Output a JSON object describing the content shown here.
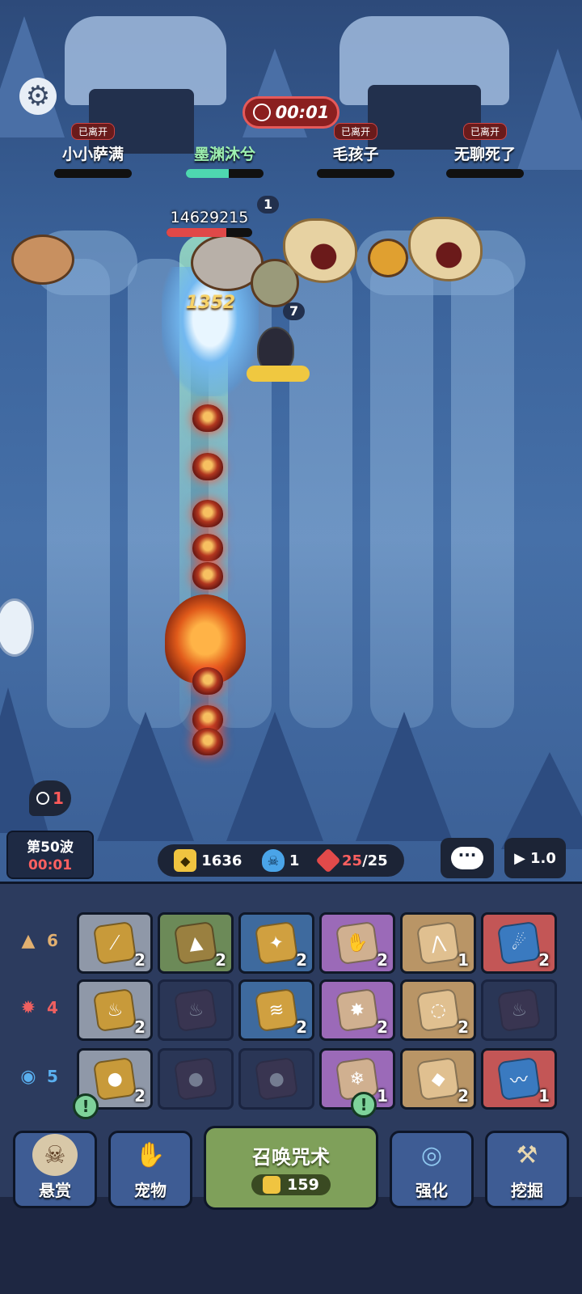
{
  "top": {
    "timer": "00:01",
    "players": [
      {
        "status": "已离开",
        "name": "小小萨满",
        "hp": 0
      },
      {
        "status": "",
        "name": "墨渊沐兮",
        "hp": 0.55
      },
      {
        "status": "已离开",
        "name": "毛孩子",
        "hp": 0
      },
      {
        "status": "已离开",
        "name": "无聊死了",
        "hp": 0
      }
    ]
  },
  "battle": {
    "boss_hp_value": "14629215",
    "boss_hp_fraction": 0.7,
    "badge_a": "1",
    "badge_b": "7",
    "damage_float": "1352",
    "side_timer": "1"
  },
  "wave": {
    "label": "第50波",
    "time": "00:01"
  },
  "resources": {
    "gold": "1636",
    "souls": "1",
    "gems_current": "25",
    "gems_sep": "/",
    "gems_max": "25"
  },
  "speed": "1.0",
  "elements": [
    {
      "count": "6",
      "icon": "mountain-icon",
      "color": "#e2b070",
      "cards": [
        {
          "color": "grey",
          "icon": "claw",
          "count": "2"
        },
        {
          "color": "green",
          "icon": "boulder",
          "count": "2"
        },
        {
          "color": "blue",
          "icon": "rocks",
          "count": "2"
        },
        {
          "color": "purple",
          "icon": "hand",
          "count": "2"
        },
        {
          "color": "tan",
          "icon": "spikes",
          "count": "1"
        },
        {
          "color": "red",
          "icon": "meteor",
          "count": "2"
        }
      ]
    },
    {
      "count": "4",
      "icon": "fire-icon",
      "color": "#f06060",
      "cards": [
        {
          "color": "grey",
          "icon": "flame",
          "count": "2"
        },
        {
          "color": "empty",
          "icon": "fire-locked",
          "count": ""
        },
        {
          "color": "blue",
          "icon": "fire-wave",
          "count": "2"
        },
        {
          "color": "purple",
          "icon": "explosion",
          "count": "2"
        },
        {
          "color": "tan",
          "icon": "tornado",
          "count": "2"
        },
        {
          "color": "empty",
          "icon": "fire-locked",
          "count": ""
        }
      ]
    },
    {
      "count": "5",
      "icon": "water-icon",
      "color": "#5ab0f0",
      "cards": [
        {
          "color": "grey",
          "icon": "droplet",
          "count": "2"
        },
        {
          "color": "empty",
          "icon": "water-locked",
          "count": ""
        },
        {
          "color": "empty",
          "icon": "water-locked",
          "count": ""
        },
        {
          "color": "purple",
          "icon": "snowflake",
          "count": "1"
        },
        {
          "color": "tan",
          "icon": "ice-crystal",
          "count": "2"
        },
        {
          "color": "red",
          "icon": "wave",
          "count": "1"
        }
      ]
    }
  ],
  "bottom": {
    "bounty": "悬赏",
    "pet": "宠物",
    "summon": "召唤咒术",
    "summon_cost": "159",
    "upgrade": "强化",
    "dig": "挖掘",
    "alert_mark": "!"
  }
}
